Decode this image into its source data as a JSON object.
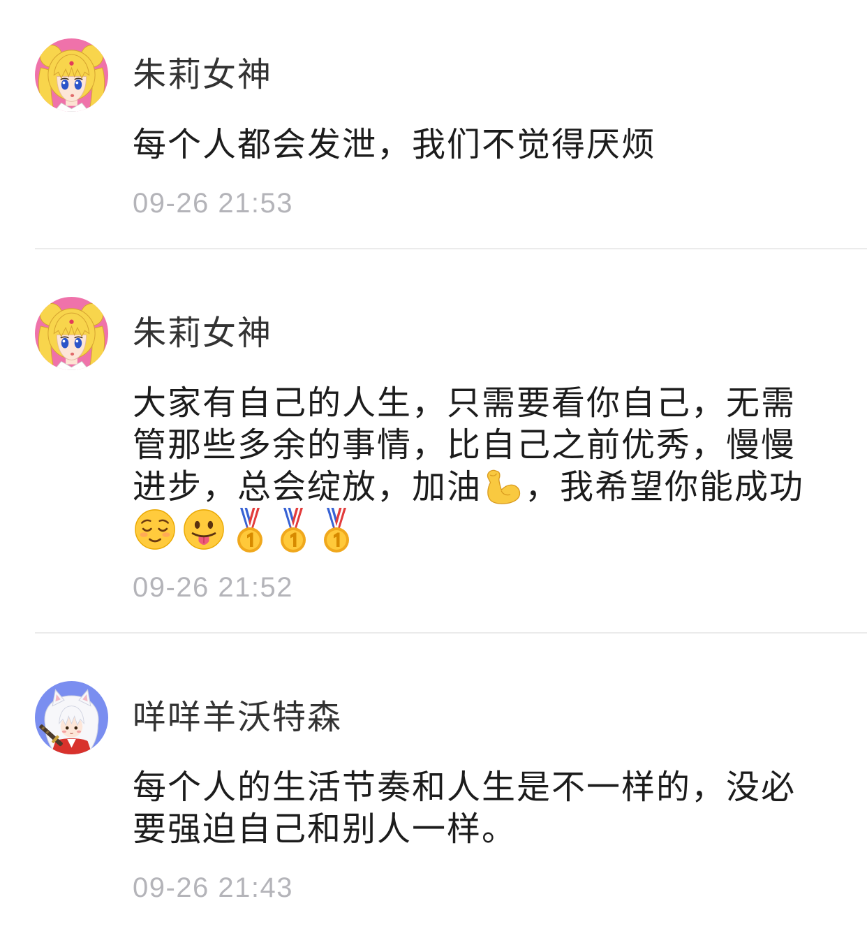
{
  "colors": {
    "author-name": "#333333",
    "comment-text": "#1c1c1c",
    "timestamp": "#b4b4b9",
    "divider": "#ebebeb",
    "background": "#ffffff"
  },
  "comments": [
    {
      "author": "朱莉女神",
      "avatar": "sailor-moon-avatar",
      "lines": [
        [
          {
            "text": "每个人都会发泄，我们不觉得厌烦"
          }
        ]
      ],
      "time": "09-26 21:53"
    },
    {
      "author": "朱莉女神",
      "avatar": "sailor-moon-avatar",
      "lines": [
        [
          {
            "text": "大家有自己的人生，只需要看你自己，无需"
          }
        ],
        [
          {
            "text": "管那些多余的事情，比自己之前优秀，慢慢"
          }
        ],
        [
          {
            "text": "进步，总会绽放，加油"
          },
          {
            "emoji": "flexed-biceps"
          },
          {
            "text": "，我希望你能成功"
          }
        ],
        [
          {
            "emoji": "relieved-face"
          },
          {
            "emoji": "face-with-tongue"
          },
          {
            "emoji": "first-place-medal"
          },
          {
            "emoji": "first-place-medal"
          },
          {
            "emoji": "first-place-medal"
          }
        ]
      ],
      "time": "09-26 21:52"
    },
    {
      "author": "咩咩羊沃特森",
      "avatar": "inuyasha-avatar",
      "lines": [
        [
          {
            "text": "每个人的生活节奏和人生是不一样的，没必"
          }
        ],
        [
          {
            "text": "要强迫自己和别人一样。"
          }
        ]
      ],
      "time": "09-26 21:43"
    }
  ]
}
